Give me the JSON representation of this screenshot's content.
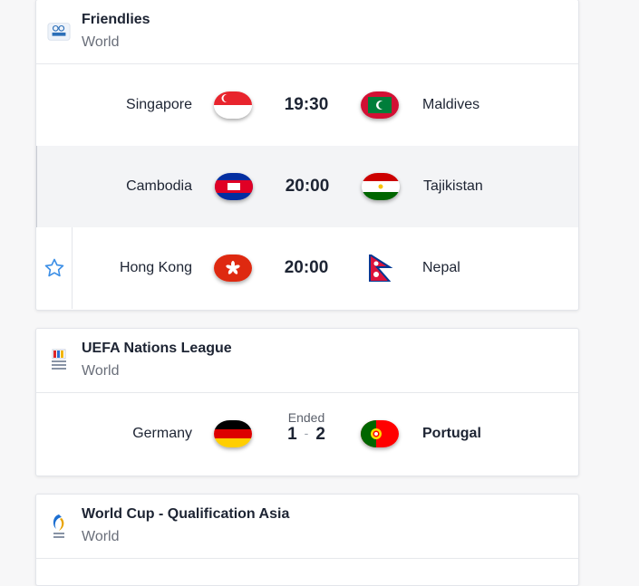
{
  "cards": [
    {
      "title": "Friendlies",
      "country": "World",
      "matches": [
        {
          "home": "Singapore",
          "away": "Maldives",
          "time": "19:30"
        },
        {
          "home": "Cambodia",
          "away": "Tajikistan",
          "time": "20:00"
        },
        {
          "home": "Hong Kong",
          "away": "Nepal",
          "time": "20:00"
        }
      ]
    },
    {
      "title": "UEFA Nations League",
      "country": "World",
      "matches": [
        {
          "home": "Germany",
          "away": "Portugal",
          "status": "Ended",
          "home_score": "1",
          "score_sep": "-",
          "away_score": "2"
        }
      ]
    },
    {
      "title": "World Cup - Qualification Asia",
      "country": "World"
    }
  ],
  "logos": {
    "friendlies": "FIFA",
    "nations": "NATIONS LEAGUE"
  },
  "colors": {
    "star": "#3b8ee6",
    "hover_row": "#f3f4f6"
  }
}
